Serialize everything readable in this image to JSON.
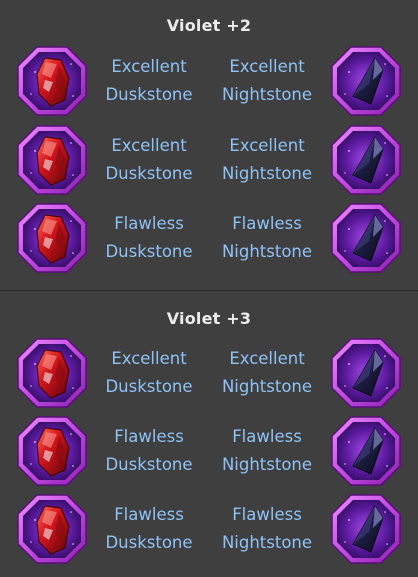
{
  "sections": [
    {
      "title": "Violet +2",
      "rows": [
        {
          "left": {
            "quality": "Excellent",
            "name": "Duskstone",
            "icon": "duskstone-icon"
          },
          "right": {
            "quality": "Excellent",
            "name": "Nightstone",
            "icon": "nightstone-icon"
          }
        },
        {
          "left": {
            "quality": "Excellent",
            "name": "Duskstone",
            "icon": "duskstone-icon"
          },
          "right": {
            "quality": "Excellent",
            "name": "Nightstone",
            "icon": "nightstone-icon"
          }
        },
        {
          "left": {
            "quality": "Flawless",
            "name": "Duskstone",
            "icon": "duskstone-icon"
          },
          "right": {
            "quality": "Flawless",
            "name": "Nightstone",
            "icon": "nightstone-icon"
          }
        }
      ]
    },
    {
      "title": "Violet +3",
      "rows": [
        {
          "left": {
            "quality": "Excellent",
            "name": "Duskstone",
            "icon": "duskstone-icon"
          },
          "right": {
            "quality": "Excellent",
            "name": "Nightstone",
            "icon": "nightstone-icon"
          }
        },
        {
          "left": {
            "quality": "Flawless",
            "name": "Duskstone",
            "icon": "duskstone-icon"
          },
          "right": {
            "quality": "Flawless",
            "name": "Nightstone",
            "icon": "nightstone-icon"
          }
        },
        {
          "left": {
            "quality": "Flawless",
            "name": "Duskstone",
            "icon": "duskstone-icon"
          },
          "right": {
            "quality": "Flawless",
            "name": "Nightstone",
            "icon": "nightstone-icon"
          }
        }
      ]
    }
  ],
  "colors": {
    "background": "#3f3f3f",
    "title": "#ececec",
    "label": "#8fc2f5",
    "frame": "#c44fe0",
    "duskstone": "#c4151b",
    "nightstone": "#262650"
  }
}
